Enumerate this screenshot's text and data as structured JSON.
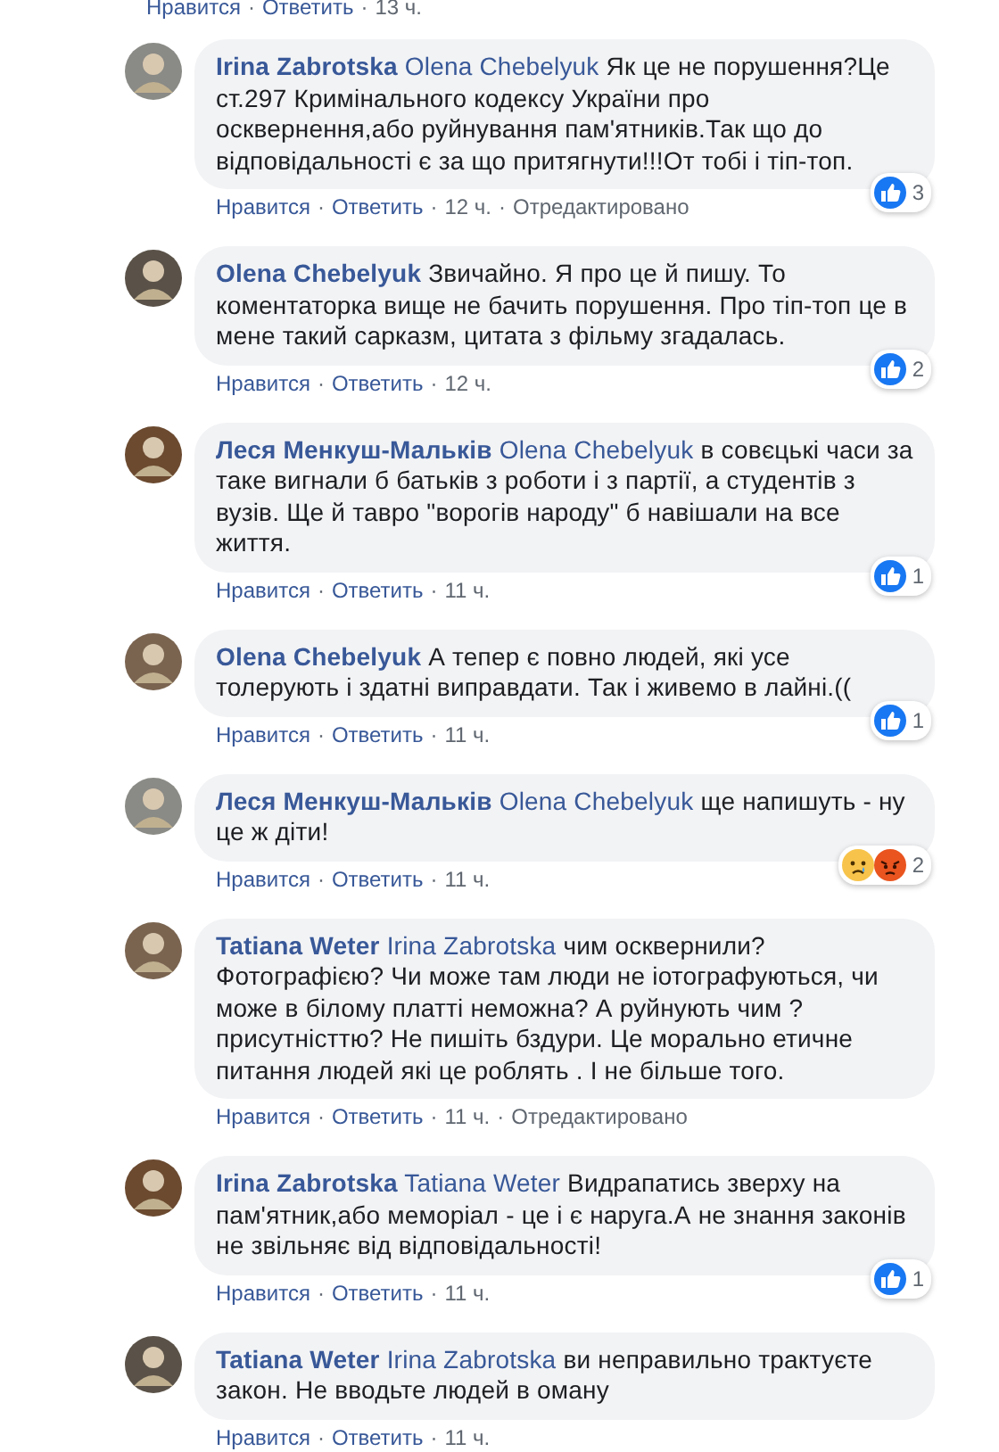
{
  "separator": "·",
  "top_actions": [
    "Нравится",
    "Ответить",
    "13 ч."
  ],
  "comments": [
    {
      "author": "Irina Zabrotska",
      "mention": "Olena Chebelyuk",
      "text": "Як це не порушення?Це ст.297 Кримінального кодексу України про осквернення,або руйнування пам'ятників.Так що до відповідальності є за що притягнути!!!От тобі і тіп-топ.",
      "actions": [
        "Нравится",
        "Ответить",
        "12 ч.",
        "Отредактировано"
      ],
      "reactions": {
        "items": [
          {
            "kind": "like"
          }
        ],
        "count": "3"
      }
    },
    {
      "author": "Olena Chebelyuk",
      "text": "Звичайно. Я про це й пишу. То коментаторка вище не бачить порушення. Про тіп-топ це в мене такий сарказм, цитата з фільму згадалась.",
      "actions": [
        "Нравится",
        "Ответить",
        "12 ч."
      ],
      "reactions": {
        "items": [
          {
            "kind": "like"
          }
        ],
        "count": "2"
      }
    },
    {
      "author": "Леся Менкуш-Мальків",
      "mention": "Olena Chebelyuk",
      "text": "в совєцькі часи за таке вигнали б батьків з роботи і з партії, а студентів з вузів. Ще й тавро \"ворогів народу\" б навішали на все життя.",
      "actions": [
        "Нравится",
        "Ответить",
        "11 ч."
      ],
      "reactions": {
        "items": [
          {
            "kind": "like"
          }
        ],
        "count": "1"
      }
    },
    {
      "author": "Olena Chebelyuk",
      "text": "А тепер є повно людей, які усе толерують і здатні виправдати. Так і живемо в лайні.((",
      "actions": [
        "Нравится",
        "Ответить",
        "11 ч."
      ],
      "reactions": {
        "items": [
          {
            "kind": "like"
          }
        ],
        "count": "1"
      }
    },
    {
      "author": "Леся Менкуш-Мальків",
      "mention": "Olena Chebelyuk",
      "text": "ще напишуть - ну це ж діти!",
      "actions": [
        "Нравится",
        "Ответить",
        "11 ч."
      ],
      "reactions": {
        "items": [
          {
            "kind": "sad"
          },
          {
            "kind": "angry"
          }
        ],
        "count": "2"
      }
    },
    {
      "author": "Tatiana Weter",
      "mention": "Irina Zabrotska",
      "text": "чим осквернили? Фотографією? Чи може там люди не іотографуються, чи може в білому платті неможна? А руйнують чим ? присутністтю? Не пишіть бздури. Це морально етичне питання людей які це роблять . І не більше того.",
      "actions": [
        "Нравится",
        "Ответить",
        "11 ч.",
        "Отредактировано"
      ]
    },
    {
      "author": "Irina Zabrotska",
      "mention": "Tatiana Weter",
      "text": "Видрапатись зверху на пам'ятник,або меморіал - це і є наруга.А не знання законів не звільняє від відповідальності!",
      "actions": [
        "Нравится",
        "Ответить",
        "11 ч."
      ],
      "reactions": {
        "items": [
          {
            "kind": "like"
          }
        ],
        "count": "1"
      }
    },
    {
      "author": "Tatiana Weter",
      "mention": "Irina Zabrotska",
      "text": "ви неправильно трактуєте закон. Не вводьте людей в оману",
      "actions": [
        "Нравится",
        "Ответить",
        "11 ч."
      ]
    }
  ]
}
